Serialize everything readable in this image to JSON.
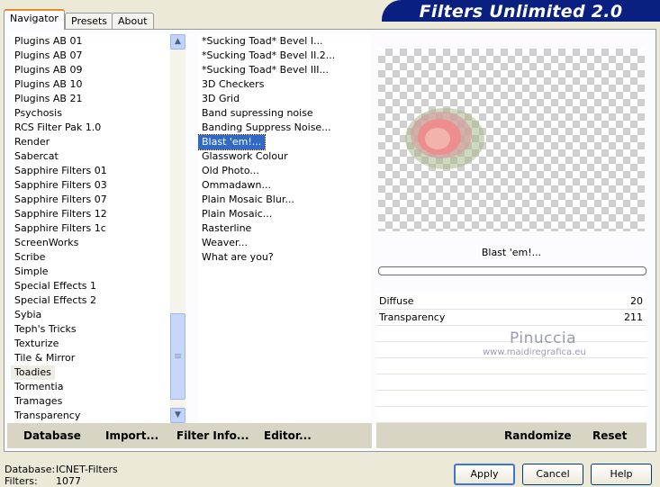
{
  "app_title": "Filters Unlimited 2.0",
  "tabs": [
    {
      "label": "Navigator"
    },
    {
      "label": "Presets"
    },
    {
      "label": "About"
    }
  ],
  "categories": [
    "Plugins AB 01",
    "Plugins AB 07",
    "Plugins AB 09",
    "Plugins AB 10",
    "Plugins AB 21",
    "Psychosis",
    "RCS Filter Pak 1.0",
    "Render",
    "Sabercat",
    "Sapphire Filters 01",
    "Sapphire Filters 03",
    "Sapphire Filters 07",
    "Sapphire Filters 12",
    "Sapphire Filters 1c",
    "ScreenWorks",
    "Scribe",
    "Simple",
    "Special Effects 1",
    "Special Effects 2",
    "Sybia",
    "Teph's Tricks",
    "Texturize",
    "Tile & Mirror",
    "Toadies",
    "Tormentia",
    "Tramages",
    "Transparency"
  ],
  "selected_category": "Toadies",
  "filters": [
    "*Sucking Toad*  Bevel I...",
    "*Sucking Toad*  Bevel II.2...",
    "*Sucking Toad*  Bevel III...",
    "3D Checkers",
    "3D Grid",
    "Band supressing noise",
    "Banding Suppress Noise...",
    "Blast 'em!...",
    "Glasswork Colour",
    "Old Photo...",
    "Ommadawn...",
    "Plain Mosaic Blur...",
    "Plain Mosaic...",
    "Rasterline",
    "Weaver...",
    "What are you?"
  ],
  "selected_filter": "Blast 'em!...",
  "preview_filter_name": "Blast 'em!...",
  "params": [
    {
      "name": "Diffuse",
      "value": "20"
    },
    {
      "name": "Transparency",
      "value": "211"
    }
  ],
  "watermark": {
    "line1": "Pinuccia",
    "line2": "www.maidiregrafica.eu"
  },
  "left_buttons": [
    "Database",
    "Import...",
    "Filter Info...",
    "Editor..."
  ],
  "right_buttons": [
    "Randomize",
    "Reset"
  ],
  "status": {
    "database_label": "Database:",
    "database_value": "ICNET-Filters",
    "filters_label": "Filters:",
    "filters_value": "1077"
  },
  "dialog_buttons": {
    "apply": "Apply",
    "cancel": "Cancel",
    "help": "Help"
  },
  "colors": {
    "banner": "#0a2080",
    "selection": "#316ac5",
    "dialog_bg": "#ece9d8"
  },
  "icons": {
    "scroll_up": "scroll-up-arrow-icon",
    "scroll_down": "scroll-down-arrow-icon"
  }
}
